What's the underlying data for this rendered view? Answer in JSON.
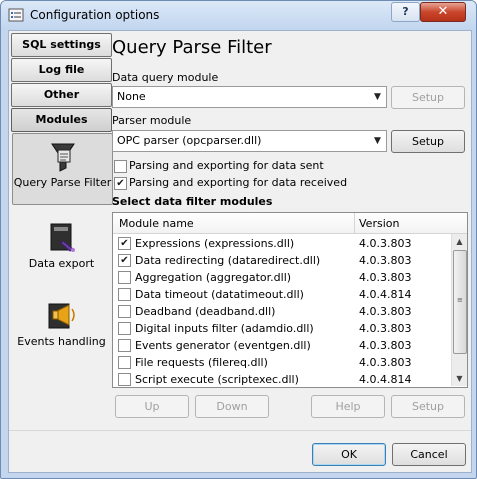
{
  "window": {
    "title": "Configuration options",
    "help_label": "?",
    "close_label": "✕"
  },
  "nav": {
    "buttons": [
      {
        "label": "SQL settings"
      },
      {
        "label": "Log file"
      },
      {
        "label": "Other"
      },
      {
        "label": "Modules"
      }
    ],
    "items": [
      {
        "label": "Query Parse Filter",
        "icon": "query-parse-filter-icon",
        "selected": true
      },
      {
        "label": "Data export",
        "icon": "data-export-icon"
      },
      {
        "label": "Events handling",
        "icon": "events-handling-icon"
      }
    ]
  },
  "panel": {
    "heading": "Query Parse Filter",
    "data_query_module": {
      "label": "Data query module",
      "value": "None",
      "setup_label": "Setup"
    },
    "parser_module": {
      "label": "Parser module",
      "value": "OPC parser (opcparser.dll)",
      "setup_label": "Setup"
    },
    "options": [
      {
        "label": "Parsing and exporting for data sent",
        "checked": false
      },
      {
        "label": "Parsing and exporting for data received",
        "checked": true
      }
    ],
    "filter_section_label": "Select data filter modules",
    "columns": {
      "name": "Module name",
      "version": "Version"
    },
    "modules": [
      {
        "name": "Expressions (expressions.dll)",
        "version": "4.0.3.803",
        "checked": true
      },
      {
        "name": "Data redirecting (dataredirect.dll)",
        "version": "4.0.3.803",
        "checked": true
      },
      {
        "name": "Aggregation (aggregator.dll)",
        "version": "4.0.3.803",
        "checked": false
      },
      {
        "name": "Data timeout (datatimeout.dll)",
        "version": "4.0.4.814",
        "checked": false
      },
      {
        "name": "Deadband (deadband.dll)",
        "version": "4.0.3.803",
        "checked": false
      },
      {
        "name": "Digital inputs filter (adamdio.dll)",
        "version": "4.0.3.803",
        "checked": false
      },
      {
        "name": "Events generator (eventgen.dll)",
        "version": "4.0.3.803",
        "checked": false
      },
      {
        "name": "File requests (filereq.dll)",
        "version": "4.0.3.803",
        "checked": false
      },
      {
        "name": "Script execute (scriptexec.dll)",
        "version": "4.0.4.814",
        "checked": false
      }
    ],
    "list_buttons": {
      "up": "Up",
      "down": "Down",
      "help": "Help",
      "setup": "Setup"
    }
  },
  "footer": {
    "ok": "OK",
    "cancel": "Cancel"
  },
  "colors": {
    "frame": "#c3d6ee",
    "client": "#f0f0f0",
    "close": "#c9452c"
  }
}
